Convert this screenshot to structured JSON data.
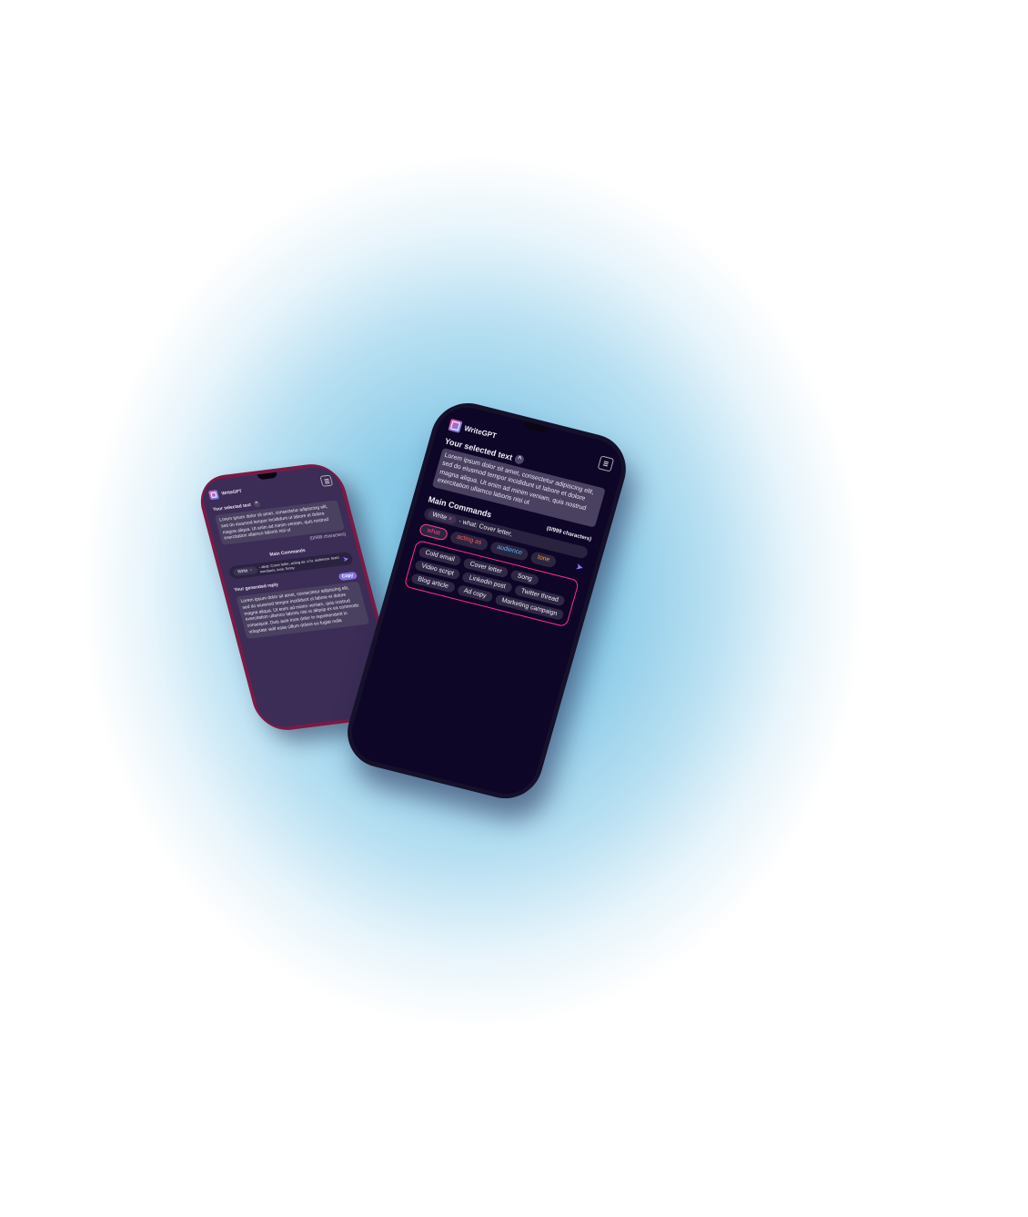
{
  "app_name": "WriteGPT",
  "back_phone": {
    "selected_text_title": "Your selected text",
    "selected_text_body": "Lorem ipsum dolor sit amet, consectetur adipiscing elit, sed do eiusmod tempor incididunt ut labore et dolore magna aliqua. Ut enim ad minim veniam, quis nostrud exercitation ullamco laboris nisi ut",
    "char_count": "(0/999 characters)",
    "main_commands_title": "Main Commands",
    "command_chip": "Write",
    "command_text": "- what: Cover letter, acting as: a hr, audience: team members, tone: funny",
    "reply_title": "Your generated reply",
    "reply_badge": "Copy",
    "reply_body": "Lorem ipsum dolor sit amet, consectetur adipiscing elit, sed do eiusmod tempor incididunt ut labore et dolore magna aliqua. Ut enim ad minim veniam, quis nostrud exercitation ullamco laboris nisi ut aliquip ex ea commodo consequat. Duis aute irure dolor in reprehenderit in voluptate velit esse cillum dolore eu fugiat nulla"
  },
  "front_phone": {
    "selected_text_title": "Your selected text",
    "selected_text_body": "Lorem ipsum dolor sit amet, consectetur adipiscing elit, sed do eiusmod tempor incididunt ut labore et dolore magna aliqua. Ut enim ad minim veniam, quis nostrud exercitation ullamco laboris nisi ut",
    "main_commands_title": "Main Commands",
    "char_count": "(0/999 characters)",
    "command_chip": "Write",
    "command_text": "- what: Cover letter,",
    "tags": [
      "what",
      "acting as",
      "audience",
      "tone"
    ],
    "suggestions": [
      "Cold email",
      "Cover letter",
      "Song",
      "Video script",
      "Linkedin post",
      "Twitter thread",
      "Blog article",
      "Ad copy",
      "Marketing campaign"
    ]
  },
  "colors": {
    "accent_pink": "#ff2e88",
    "what": "#ff3f8a",
    "acting_as": "#ff5b5b",
    "audience": "#55b8ff",
    "tone": "#ff9a2a",
    "send": "#8c7bff"
  }
}
